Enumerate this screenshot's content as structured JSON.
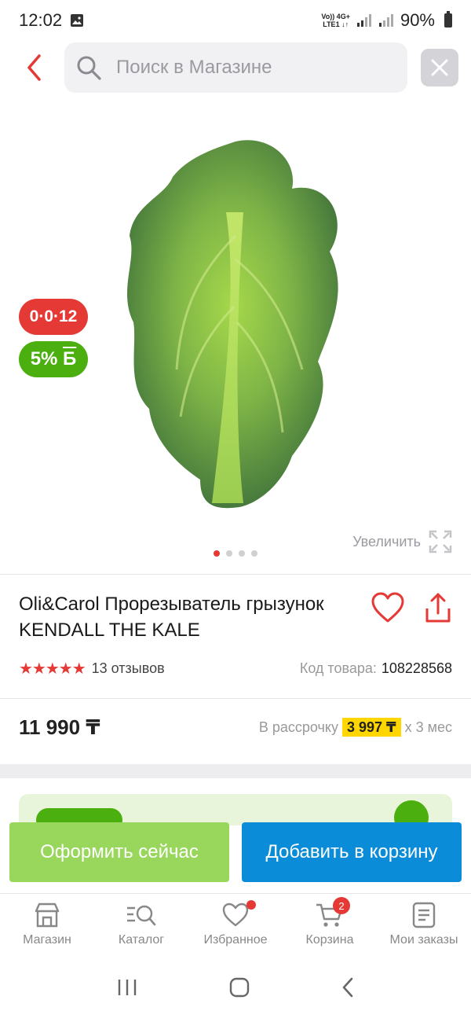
{
  "status": {
    "time": "12:02",
    "net_top": "Vo)) 4G+",
    "net_bottom": "LTE1 ↓↑",
    "battery": "90%"
  },
  "search": {
    "placeholder": "Поиск в Магазине"
  },
  "badges": {
    "installment": "0·0·12",
    "bonus_value": "5%",
    "bonus_unit": "Б"
  },
  "image": {
    "zoom_label": "Увеличить",
    "slide_count": 4,
    "active_slide": 1
  },
  "product": {
    "title": "Oli&Carol Прорезыватель грызунок KENDALL THE KALE",
    "rating_stars": "★★★★★",
    "rating_value": 4.5,
    "reviews": "13 отзывов",
    "code_label": "Код товара:",
    "code_value": "108228568",
    "price": "11 990 ₸",
    "installment_prefix": "В рассрочку",
    "installment_amount": "3 997 ₸",
    "installment_suffix": "x 3 мес"
  },
  "actions": {
    "buy_now": "Оформить сейчас",
    "add_to_cart": "Добавить в корзину"
  },
  "tabs": [
    {
      "label": "Магазин",
      "icon": "shop-icon"
    },
    {
      "label": "Каталог",
      "icon": "catalog-icon"
    },
    {
      "label": "Избранное",
      "icon": "heart-icon"
    },
    {
      "label": "Корзина",
      "icon": "cart-icon",
      "badge": "2"
    },
    {
      "label": "Мои заказы",
      "icon": "orders-icon"
    }
  ],
  "colors": {
    "accent_red": "#e53935",
    "primary_blue": "#0a8cd8",
    "buy_green": "#99d65c",
    "bonus_green": "#4caf10",
    "highlight_yellow": "#ffd600"
  }
}
